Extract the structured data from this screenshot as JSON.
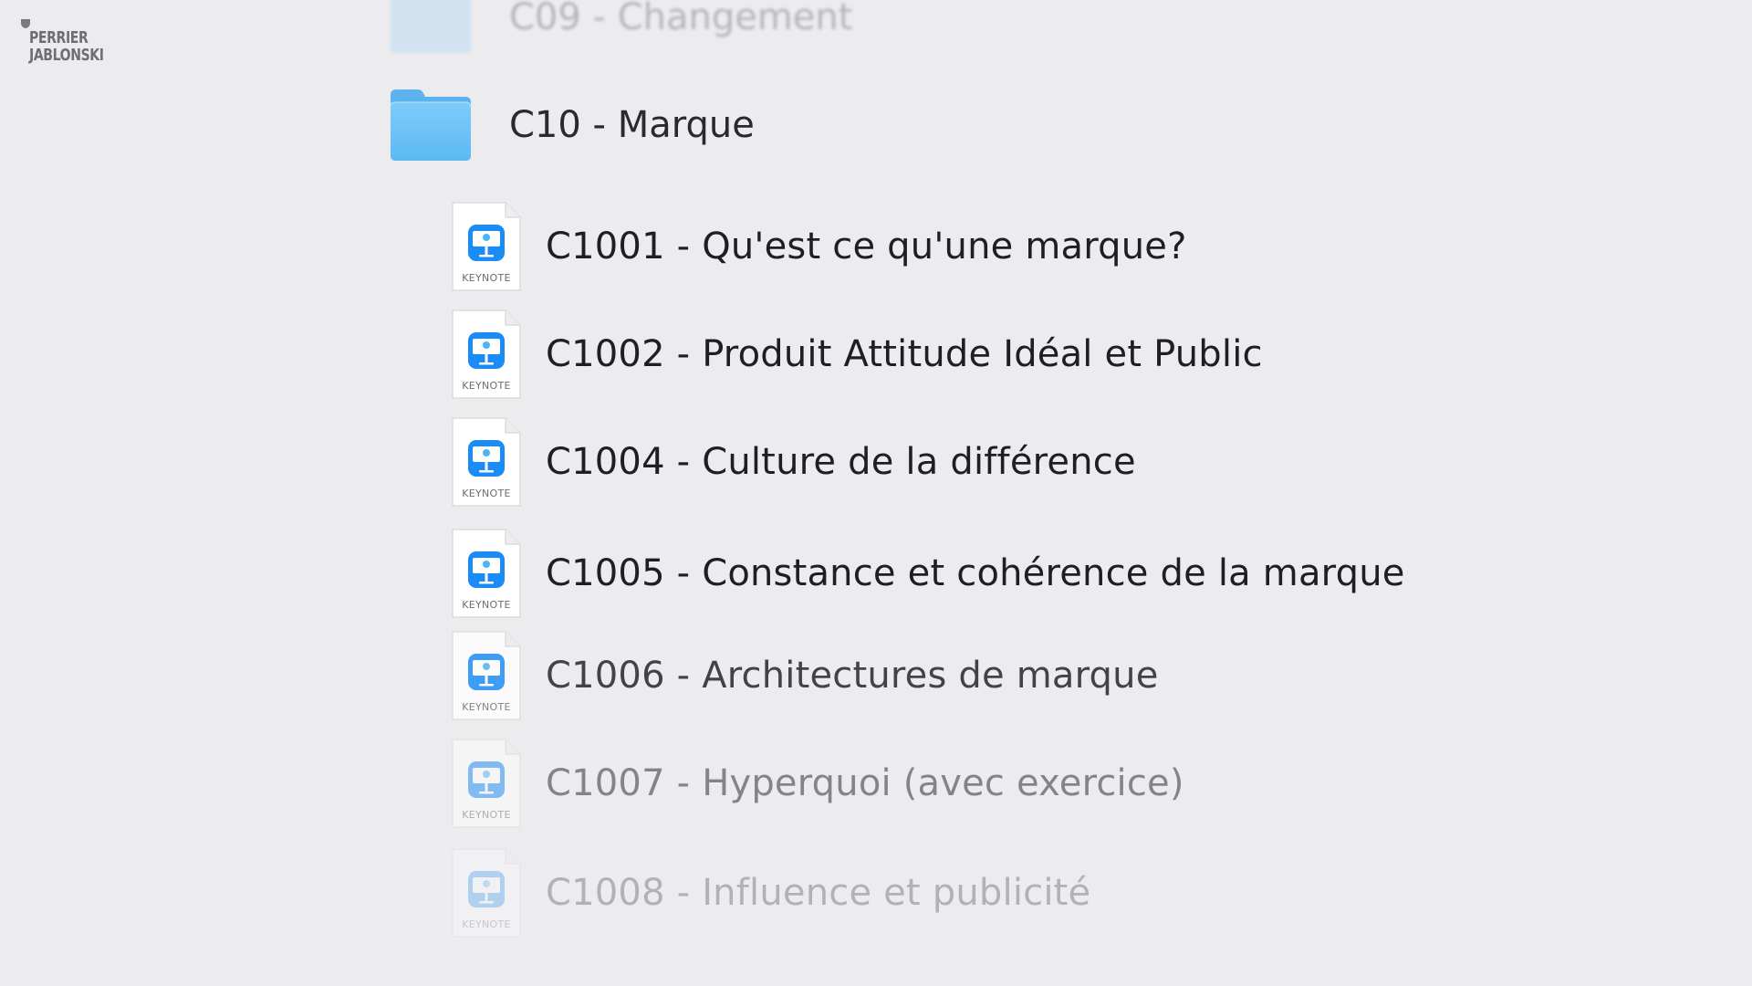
{
  "logo": {
    "line1": "PERRIER",
    "line2": "JABLONSKI"
  },
  "folders": [
    {
      "label": "C09 - Changement",
      "icon": "folder-icon"
    },
    {
      "label": "C10 - Marque",
      "icon": "folder-icon"
    }
  ],
  "files": [
    {
      "label": "C1001 - Qu'est ce qu'une marque?",
      "icon": "keynote-icon",
      "icon_text": "KEYNOTE"
    },
    {
      "label": "C1002 - Produit Attitude Idéal et Public",
      "icon": "keynote-icon",
      "icon_text": "KEYNOTE"
    },
    {
      "label": "C1004 - Culture de la différence",
      "icon": "keynote-icon",
      "icon_text": "KEYNOTE"
    },
    {
      "label": "C1005 - Constance et cohérence de la marque",
      "icon": "keynote-icon",
      "icon_text": "KEYNOTE"
    },
    {
      "label": "C1006 - Architectures de marque",
      "icon": "keynote-icon",
      "icon_text": "KEYNOTE"
    },
    {
      "label": "C1007 - Hyperquoi (avec exercice)",
      "icon": "keynote-icon",
      "icon_text": "KEYNOTE"
    },
    {
      "label": "C1008 - Influence et publicité",
      "icon": "keynote-icon",
      "icon_text": "KEYNOTE"
    }
  ],
  "colors": {
    "background": "#ECEBEE",
    "folder_blue": "#6CC0F5",
    "keynote_blue": "#1A8CF5"
  }
}
